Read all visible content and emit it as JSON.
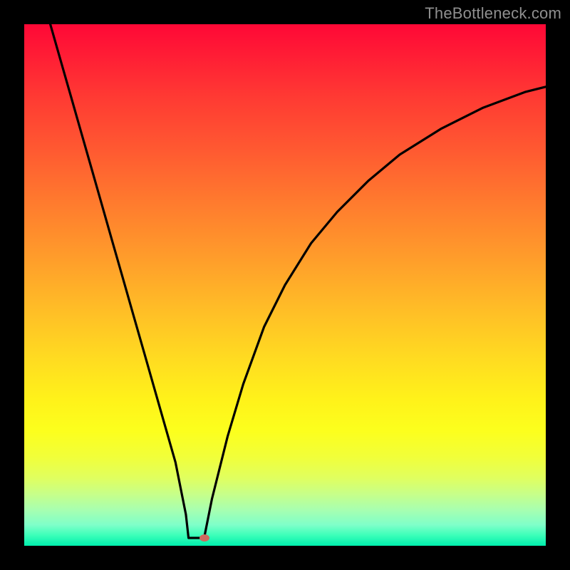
{
  "watermark": "TheBottleneck.com",
  "colors": {
    "frame": "#000000",
    "curve": "#000000",
    "dot": "#cf6a5e",
    "watermark": "#8f8f8f"
  },
  "chart_data": {
    "type": "line",
    "title": "",
    "xlabel": "",
    "ylabel": "",
    "xlim": [
      0,
      100
    ],
    "ylim": [
      0,
      100
    ],
    "series": [
      {
        "name": "bottleneck-curve",
        "x": [
          5,
          7,
          9,
          11,
          13,
          15,
          17,
          19,
          21,
          23,
          25,
          27,
          29,
          31,
          31.5,
          33,
          34.5,
          36,
          39,
          42,
          46,
          50,
          55,
          60,
          66,
          72,
          80,
          88,
          96,
          100
        ],
        "y": [
          100,
          93,
          86,
          79,
          72,
          65,
          58,
          51,
          44,
          37,
          30,
          23,
          16,
          6,
          1.5,
          1.5,
          1.5,
          9,
          21,
          31,
          42,
          50,
          58,
          64,
          70,
          75,
          80,
          84,
          87,
          88
        ]
      }
    ],
    "marker": {
      "x": 34.5,
      "y": 1.5
    },
    "grid": false,
    "legend": false
  }
}
